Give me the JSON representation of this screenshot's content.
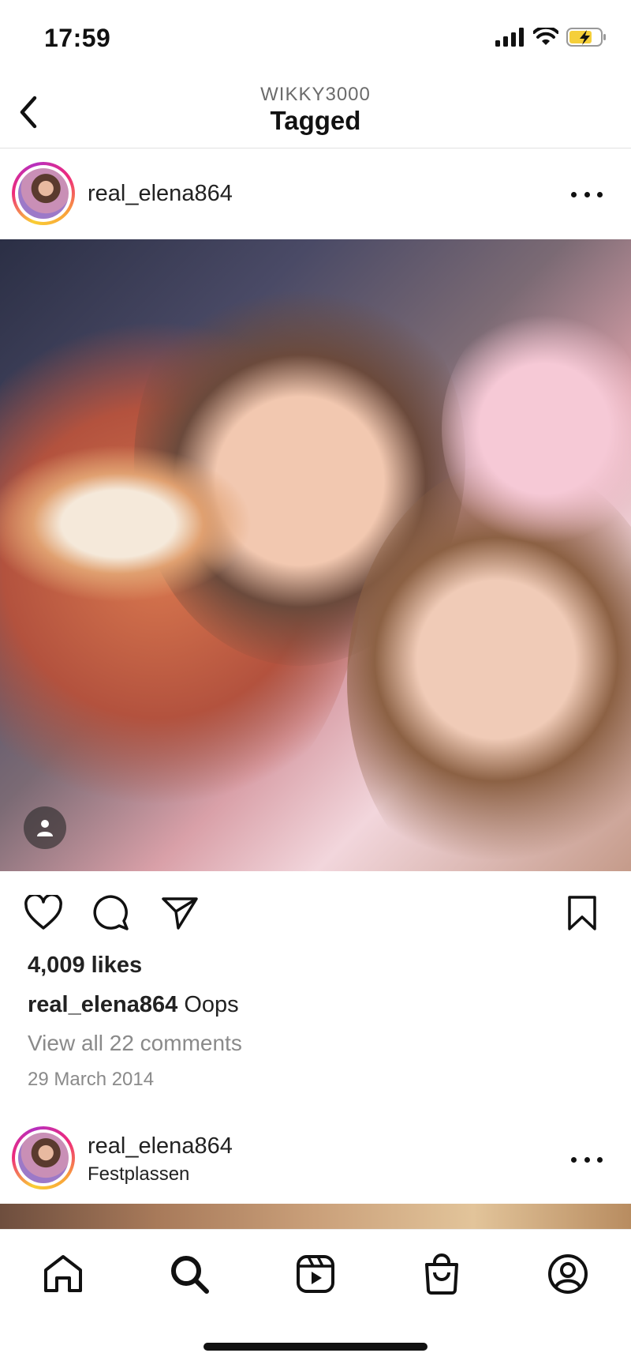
{
  "status_bar": {
    "time": "17:59"
  },
  "header": {
    "subtitle": "WIKKY3000",
    "title": "Tagged"
  },
  "posts": [
    {
      "username": "real_elena864",
      "likes": "4,009 likes",
      "caption_user": "real_elena864",
      "caption_text": "Oops",
      "view_comments": "View all 22 comments",
      "date": "29 March 2014"
    },
    {
      "username": "real_elena864",
      "location": "Festplassen"
    }
  ],
  "colors": {
    "text": "#111111",
    "muted": "#8a8a8a",
    "divider": "#e2e2e2"
  },
  "icons": {
    "status": [
      "signal-icon",
      "wifi-icon",
      "battery-charging-icon"
    ],
    "actions": [
      "heart-icon",
      "comment-icon",
      "share-icon",
      "bookmark-icon"
    ],
    "tabbar": [
      "home-icon",
      "search-icon",
      "reels-icon",
      "shop-icon",
      "profile-icon"
    ]
  }
}
